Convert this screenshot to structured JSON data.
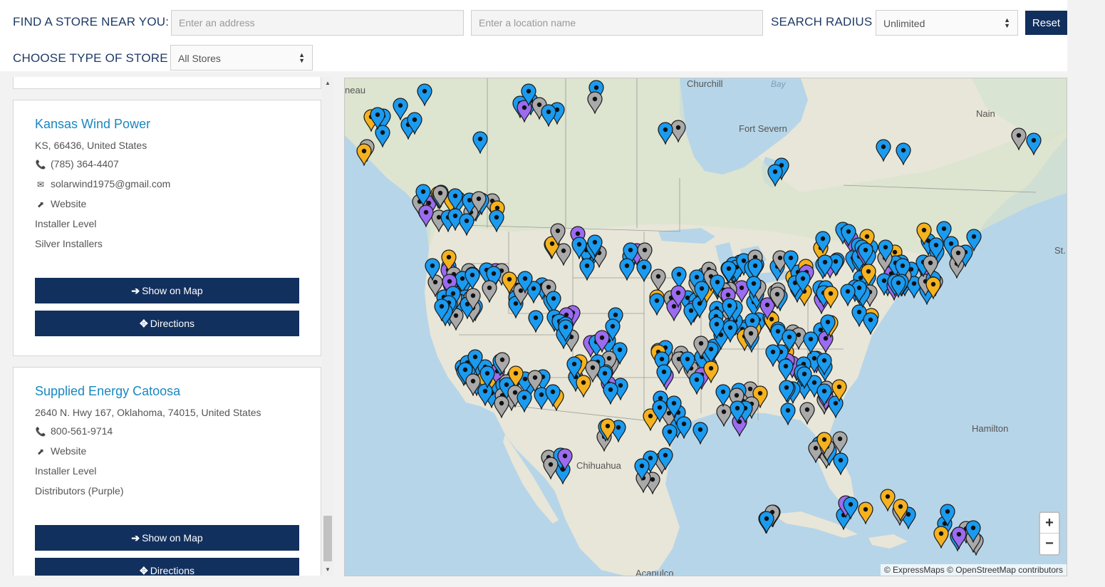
{
  "search": {
    "find_label": "FIND A STORE NEAR YOU:",
    "address_placeholder": "Enter an address",
    "location_placeholder": "Enter a location name",
    "radius_label": "SEARCH RADIUS",
    "radius_value": "Unlimited",
    "reset_label": "Reset",
    "type_label": "CHOOSE TYPE OF STORE",
    "type_value": "All Stores"
  },
  "stores": [
    {
      "name": "Kansas Wind Power",
      "address": "KS, 66436, United States",
      "phone": "(785) 364-4407",
      "email": "solarwind1975@gmail.com",
      "website": "Website",
      "level": "Installer Level",
      "tier": "Silver Installers",
      "show_on_map": "Show on Map",
      "directions": "Directions"
    },
    {
      "name": "Supplied Energy Catoosa",
      "address": "2640 N. Hwy 167, Oklahoma, 74015, United States",
      "phone": "800-561-9714",
      "website": "Website",
      "level": "Installer Level",
      "tier": "Distributors (Purple)",
      "show_on_map": "Show on Map",
      "directions": "Directions"
    }
  ],
  "map": {
    "place_labels": {
      "churchill": "Churchill",
      "bay": "Bay",
      "fort_severn": "Fort Severn",
      "nain": "Nain",
      "st": "St.",
      "hamilton": "Hamilton",
      "chihuahua": "Chihuahua",
      "acapulco": "Acapulco",
      "neau": "neau"
    },
    "zoom_in": "+",
    "zoom_out": "−",
    "attribution": "© ExpressMaps © OpenStreetMap contributors",
    "marker_colors": {
      "blue": "#1a9bf0",
      "gray": "#a9a9a9",
      "purple": "#9b6bf0",
      "orange": "#f5b21e"
    },
    "icons": {
      "marker": "map-marker-icon",
      "phone": "phone-icon",
      "email": "envelope-icon",
      "website": "external-link-icon",
      "show": "arrow-right-icon",
      "directions": "arrows-move-icon"
    }
  }
}
